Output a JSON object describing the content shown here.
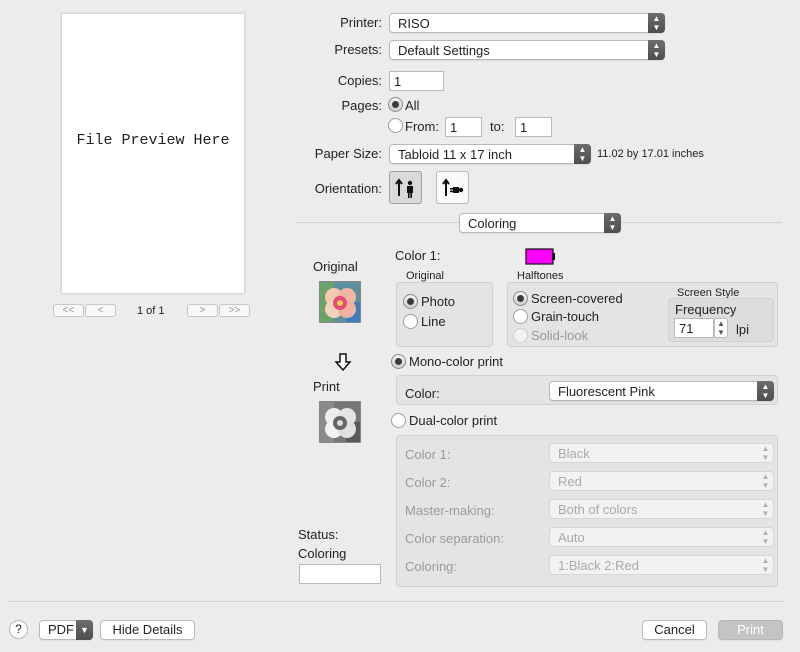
{
  "preview": {
    "text": "File Preview Here",
    "page_indicator": "1 of 1",
    "nav": {
      "first": "<<",
      "prev": "<",
      "next": ">",
      "last": ">>"
    }
  },
  "printer": {
    "label": "Printer:",
    "value": "RISO"
  },
  "presets": {
    "label": "Presets:",
    "value": "Default Settings"
  },
  "copies": {
    "label": "Copies:",
    "value": "1"
  },
  "pages": {
    "label": "Pages:",
    "all_label": "All",
    "from_label": "From:",
    "from_value": "1",
    "to_label": "to:",
    "to_value": "1",
    "selected": "All"
  },
  "paper_size": {
    "label": "Paper Size:",
    "value": "Tabloid 11 x 17 inch",
    "dimensions": "11.02 by 17.01 inches"
  },
  "orientation": {
    "label": "Orientation:",
    "selected": "portrait"
  },
  "section_popup": {
    "value": "Coloring"
  },
  "left_panel": {
    "original_label": "Original",
    "print_label": "Print",
    "status_label": "Status:",
    "status_value": "Coloring",
    "status_field": ""
  },
  "coloring": {
    "color1_label": "Color 1:",
    "color1_swatch": "#ff00ff",
    "original_group_title": "Original",
    "original_options": [
      "Photo",
      "Line"
    ],
    "original_selected": "Photo",
    "halftones_title": "Halftones",
    "halftone_options": [
      "Screen-covered",
      "Grain-touch",
      "Solid-look"
    ],
    "halftone_selected": "Screen-covered",
    "screen_style_title": "Screen Style",
    "frequency_label": "Frequency",
    "frequency_value": "71",
    "frequency_unit": "lpi",
    "mono_label": "Mono-color print",
    "mono_color_label": "Color:",
    "mono_color_value": "Fluorescent Pink",
    "dual_label": "Dual-color print",
    "dual": {
      "color1_label": "Color 1:",
      "color1_value": "Black",
      "color2_label": "Color 2:",
      "color2_value": "Red",
      "master_label": "Master-making:",
      "master_value": "Both of colors",
      "sep_label": "Color separation:",
      "sep_value": "Auto",
      "coloring_label": "Coloring:",
      "coloring_value": "1:Black 2:Red"
    },
    "selected_mode": "Mono-color print"
  },
  "footer": {
    "help": "?",
    "pdf": "PDF",
    "hide_details": "Hide Details",
    "cancel": "Cancel",
    "print": "Print"
  }
}
